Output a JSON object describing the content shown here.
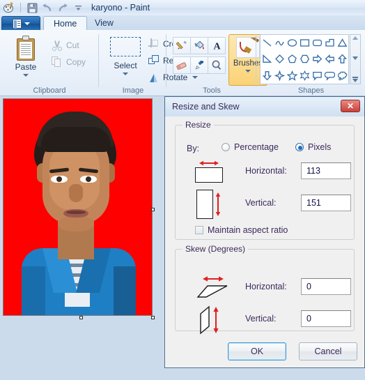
{
  "titlebar": {
    "document_title": "karyono - Paint",
    "quick_access": [
      {
        "name": "paint-app-icon",
        "label": "Paint"
      },
      {
        "name": "save-icon",
        "label": "Save"
      },
      {
        "name": "undo-icon",
        "label": "Undo"
      },
      {
        "name": "redo-icon",
        "label": "Redo"
      },
      {
        "name": "customize-qat-icon",
        "label": "Customize Quick Access Toolbar"
      }
    ]
  },
  "ribbon": {
    "app_menu_label": "Paint menu",
    "tabs": [
      {
        "label": "Home",
        "active": true
      },
      {
        "label": "View",
        "active": false
      }
    ],
    "groups": [
      {
        "name": "clipboard",
        "label": "Clipboard",
        "paste_label": "Paste",
        "commands": [
          {
            "label": "Cut",
            "icon": "scissors-icon",
            "enabled": false
          },
          {
            "label": "Copy",
            "icon": "copy-pages-icon",
            "enabled": false
          }
        ]
      },
      {
        "name": "image",
        "label": "Image",
        "select_label": "Select",
        "commands": [
          {
            "label": "Crop",
            "icon": "crop-icon",
            "enabled": false
          },
          {
            "label": "Resize",
            "icon": "resize-icon",
            "enabled": true
          },
          {
            "label": "Rotate",
            "icon": "rotate-icon",
            "enabled": true
          }
        ]
      },
      {
        "name": "tools",
        "label": "Tools",
        "brushes_label": "Brushes",
        "tool_icons": [
          "pencil-icon",
          "fill-bucket-icon",
          "text-tool-icon",
          "eraser-icon",
          "color-picker-icon",
          "magnifier-icon"
        ]
      },
      {
        "name": "shapes",
        "label": "Shapes",
        "shape_icons": [
          "line-shape-icon",
          "curve-shape-icon",
          "oval-shape-icon",
          "rectangle-shape-icon",
          "rounded-rectangle-shape-icon",
          "polygon-shape-icon",
          "triangle-shape-icon",
          "right-triangle-shape-icon",
          "diamond-shape-icon",
          "pentagon-shape-icon",
          "hexagon-shape-icon",
          "right-arrow-shape-icon",
          "left-arrow-shape-icon",
          "up-arrow-shape-icon",
          "down-arrow-shape-icon",
          "four-point-star-shape-icon",
          "five-point-star-shape-icon",
          "six-point-star-shape-icon",
          "rectangular-callout-icon",
          "rounded-callout-icon",
          "cloud-callout-icon"
        ]
      }
    ]
  },
  "canvas": {
    "image_alt": "portrait photo on red background",
    "background_color": "#fe0000",
    "shirt_color": "#1f7fc4"
  },
  "dialog": {
    "title": "Resize and Skew",
    "close_label": "✕",
    "resize": {
      "legend": "Resize",
      "by_label": "By:",
      "options": [
        {
          "label": "Percentage",
          "selected": false
        },
        {
          "label": "Pixels",
          "selected": true
        }
      ],
      "horizontal_label": "Horizontal:",
      "horizontal_value": "113",
      "vertical_label": "Vertical:",
      "vertical_value": "151",
      "maintain_aspect_label": "Maintain aspect ratio",
      "maintain_aspect_checked": false
    },
    "skew": {
      "legend": "Skew (Degrees)",
      "horizontal_label": "Horizontal:",
      "horizontal_value": "0",
      "vertical_label": "Vertical:",
      "vertical_value": "0"
    },
    "buttons": {
      "ok_label": "OK",
      "cancel_label": "Cancel"
    }
  }
}
